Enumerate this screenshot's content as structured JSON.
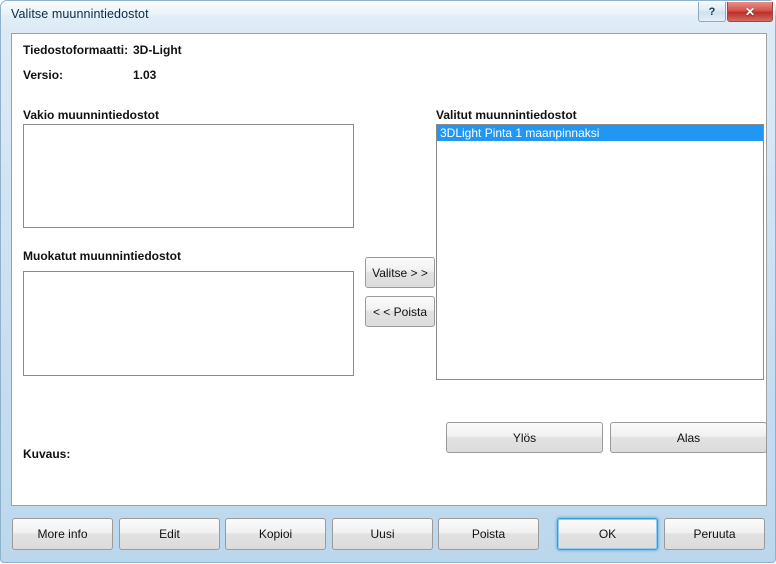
{
  "window": {
    "title": "Valitse muunnintiedostot",
    "caption_buttons": [
      {
        "name": "help-button",
        "glyph": "?"
      },
      {
        "name": "close-button",
        "glyph": "✕"
      }
    ],
    "accent_blue": "#2196f3",
    "titlebar_bg": "#cfe2f3",
    "close_red": "#bc2f28",
    "focus_ring": "#3c9bd4"
  },
  "info": {
    "format_label": "Tiedostoformaatti:",
    "format_value": "3D-Light",
    "version_label": "Versio:",
    "version_value": "1.03"
  },
  "panels": {
    "standard": {
      "label": "Vakio muunnintiedostot",
      "items": []
    },
    "modified": {
      "label": "Muokatut muunnintiedostot",
      "items": []
    },
    "selected": {
      "label": "Valitut muunnintiedostot",
      "items": [
        {
          "text": "3DLight Pinta 1 maanpinnaksi",
          "selected": true
        }
      ]
    }
  },
  "transfer": {
    "add_label": "Valitse > >",
    "remove_label": "< < Poista"
  },
  "reorder": {
    "up_label": "Ylös",
    "down_label": "Alas"
  },
  "description": {
    "label": "Kuvaus:",
    "text": ""
  },
  "footer": {
    "more_info": "More info",
    "edit": "Edit",
    "copy": "Kopioi",
    "new": "Uusi",
    "delete": "Poista",
    "ok": "OK",
    "cancel": "Peruuta"
  }
}
